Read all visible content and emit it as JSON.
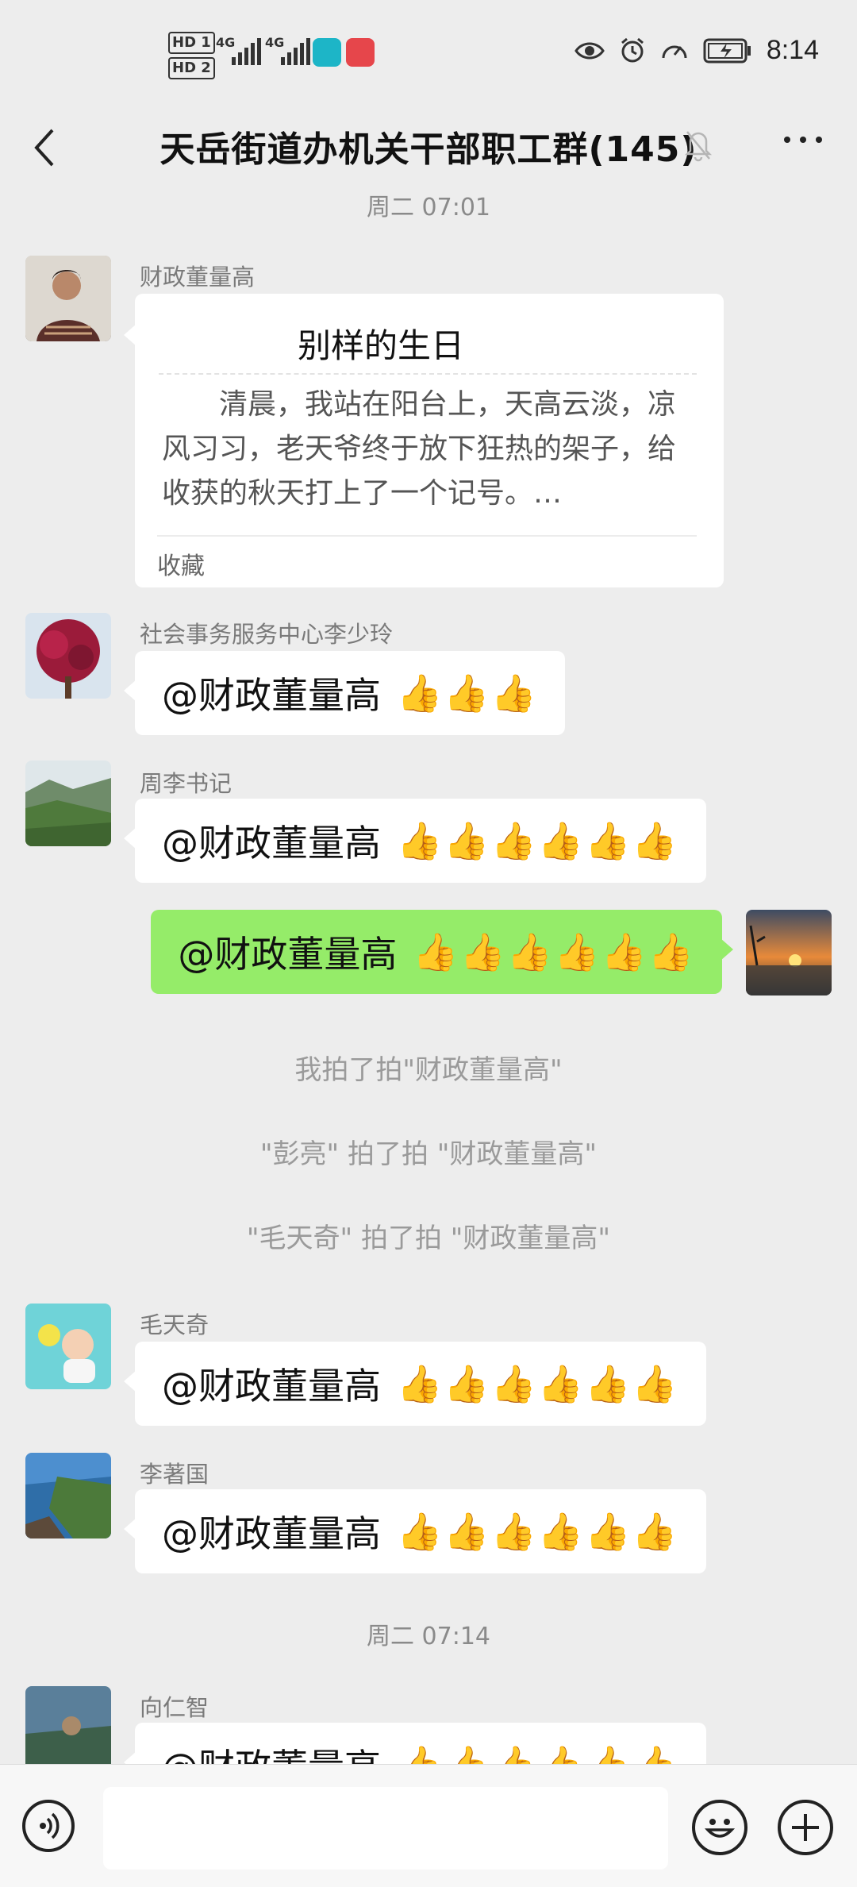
{
  "status_bar": {
    "hd1": "HD 1",
    "hd2": "HD 2",
    "net1": "4G",
    "net2": "4G",
    "time": "8:14"
  },
  "header": {
    "title": "天岳街道办机关干部职工群(145)"
  },
  "timestamps": [
    "周二 07:01",
    "周二 07:14"
  ],
  "card_message": {
    "sender": "财政董量高",
    "title": "别样的生日",
    "body": "　　清晨，我站在阳台上，天高云淡，凉风习习，老天爷终于放下狂热的架子，给收获的秋天打上了一个记号。…",
    "footer": "收藏"
  },
  "messages": [
    {
      "sender": "社会事务服务中心李少玲",
      "text": "@财政董量高",
      "thumbs": "👍👍👍"
    },
    {
      "sender": "周李书记",
      "text": "@财政董量高",
      "thumbs": "👍👍👍👍👍👍"
    },
    {
      "sender": "",
      "text": "@财政董量高",
      "thumbs": "👍👍👍👍👍👍",
      "self": true
    },
    {
      "sender": "毛天奇",
      "text": "@财政董量高",
      "thumbs": "👍👍👍👍👍👍"
    },
    {
      "sender": "李著国",
      "text": "@财政董量高",
      "thumbs": "👍👍👍👍👍👍"
    },
    {
      "sender": "向仁智",
      "text": "@财政董量高",
      "thumbs": "👍👍👍👍👍👍"
    }
  ],
  "system_messages": [
    "我拍了拍\"财政董量高\"",
    "\"彭亮\" 拍了拍 \"财政董量高\"",
    "\"毛天奇\" 拍了拍 \"财政董量高\""
  ],
  "colors": {
    "background": "#ededed",
    "self_bubble": "#95ec69",
    "other_bubble": "#ffffff"
  }
}
